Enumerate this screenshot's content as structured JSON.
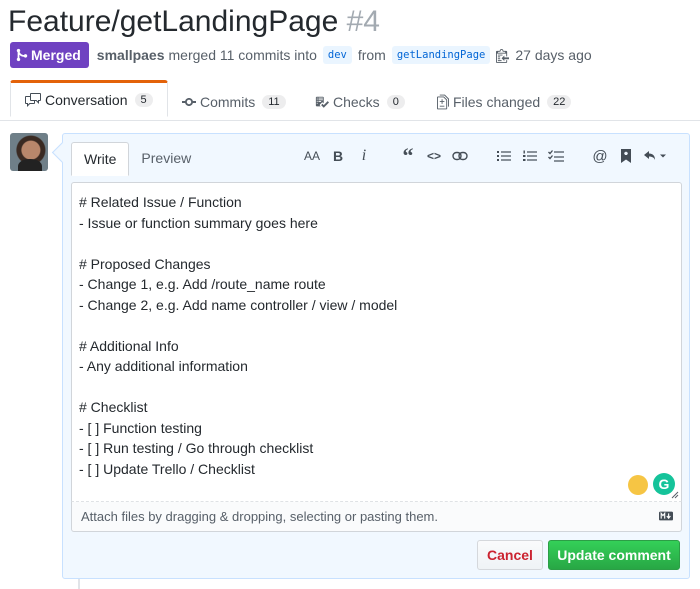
{
  "pr": {
    "title": "Feature/getLandingPage",
    "number": "#4",
    "status": "Merged",
    "author": "smallpaes",
    "action": "merged 11 commits into",
    "base_branch": "dev",
    "from_label": "from",
    "head_branch": "getLandingPage",
    "time": "27 days ago"
  },
  "tabs": [
    {
      "label": "Conversation",
      "count": "5",
      "icon": "comment-discussion-icon",
      "selected": true
    },
    {
      "label": "Commits",
      "count": "11",
      "icon": "commit-icon"
    },
    {
      "label": "Checks",
      "count": "0",
      "icon": "checklist-icon"
    },
    {
      "label": "Files changed",
      "count": "22",
      "icon": "file-diff-icon"
    }
  ],
  "editor": {
    "write_tab": "Write",
    "preview_tab": "Preview",
    "toolbar_header": "AA",
    "toolbar_bold": "B",
    "toolbar_italic": "i",
    "toolbar_quote": "“",
    "toolbar_code": "<>",
    "toolbar_mention": "@",
    "content": "# Related Issue / Function\n- Issue or function summary goes here\n\n# Proposed Changes\n- Change 1, e.g. Add /route_name route\n- Change 2, e.g. Add name controller / view / model\n\n# Additional Info\n- Any additional information\n\n# Checklist\n- [ ] Function testing\n- [ ] Run testing / Go through checklist\n- [ ] Update Trello / Checklist",
    "attach_hint": "Attach files by dragging & dropping, selecting or pasting them.",
    "grammarly_letter": "G"
  },
  "buttons": {
    "cancel": "Cancel",
    "update": "Update comment"
  },
  "colors": {
    "merged": "#6f42c1",
    "selected_tab_accent": "#e36209",
    "primary": "#28a745",
    "danger": "#cb2431",
    "link": "#0366d6"
  }
}
